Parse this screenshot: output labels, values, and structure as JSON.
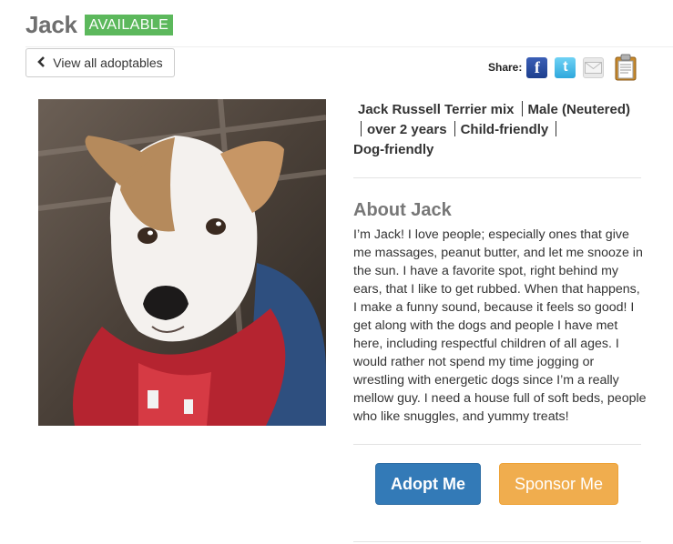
{
  "header": {
    "pet_name": "Jack",
    "status": "AVAILABLE",
    "status_color": "#5cb85c"
  },
  "nav": {
    "back_label": "View all adoptables",
    "back_icon": "chevron-left-icon"
  },
  "share": {
    "label": "Share:",
    "icons": [
      "facebook-icon",
      "twitter-icon",
      "email-icon",
      "clipboard-icon"
    ],
    "facebook_glyph": "f",
    "twitter_glyph": "t"
  },
  "traits": [
    "Jack Russell Terrier mix",
    "Male (Neutered)",
    "over 2 years",
    "Child-friendly",
    "Dog-friendly"
  ],
  "about": {
    "heading": "About Jack",
    "body": "I’m Jack! I love people; especially ones that give me massages, peanut butter, and let me snooze in the sun. I have a favorite spot, right behind my ears, that I like to get rubbed. When that happens, I make a funny sound, because it feels so good! I get along with the dogs and people I have met here, including respectful children of all ages. I would rather not spend my time jogging or wrestling with energetic dogs since I’m a really mellow guy. I need a house full of soft beds, people who like snuggles, and yummy treats!"
  },
  "actions": {
    "adopt_label": "Adopt Me",
    "sponsor_label": "Sponsor Me",
    "adopt_color": "#337ab7",
    "sponsor_color": "#f0ad4e"
  }
}
